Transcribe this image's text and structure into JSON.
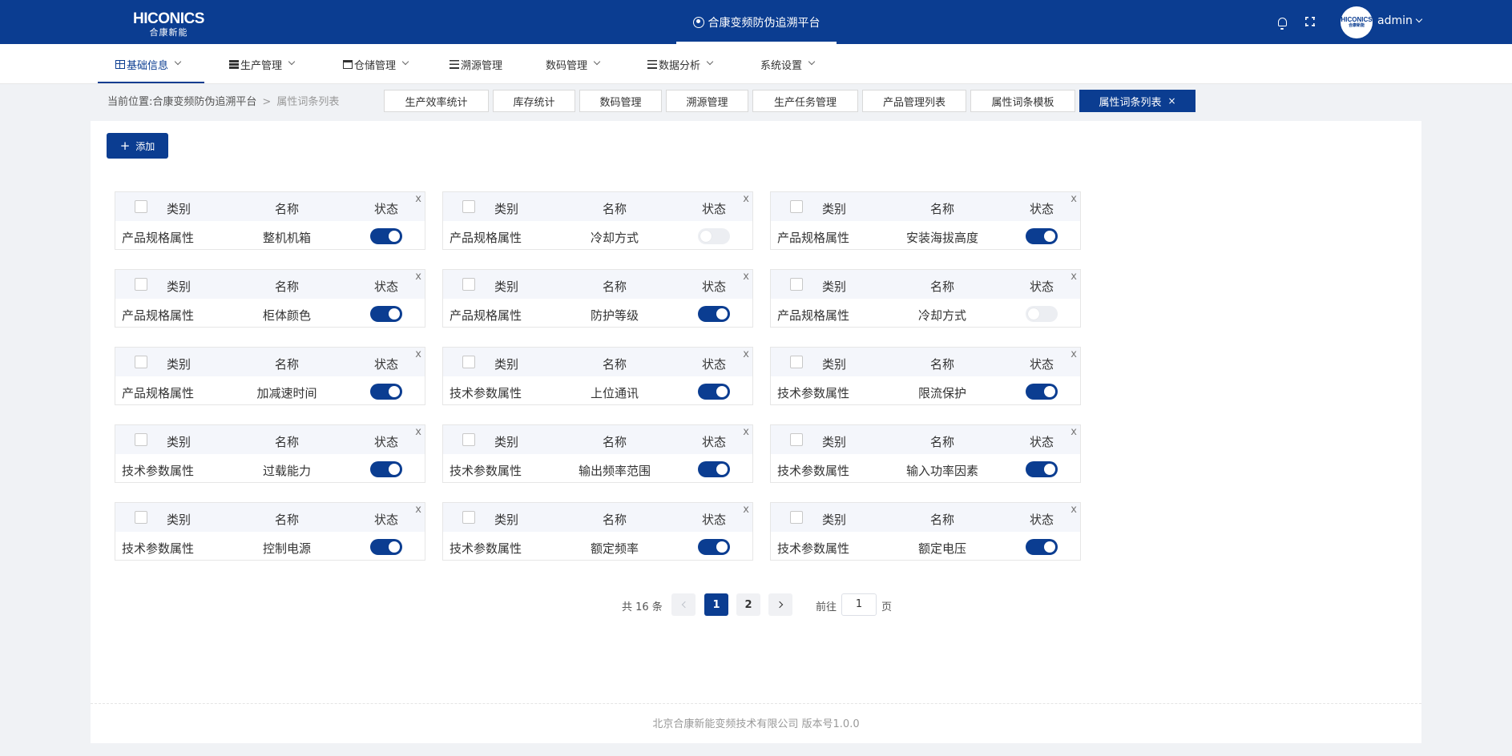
{
  "header": {
    "logo_en": "HICONICS",
    "logo_cn": "合康新能",
    "platform_title": "合康变频防伪追溯平台",
    "avatar_en": "HICONICS",
    "avatar_cn": "合康新能",
    "user": "admin"
  },
  "nav": [
    {
      "label": "基础信息",
      "icon": "grid-icon"
    },
    {
      "label": "生产管理",
      "icon": "server-icon"
    },
    {
      "label": "仓储管理",
      "icon": "archive-icon"
    },
    {
      "label": "溯源管理",
      "icon": "list-icon"
    },
    {
      "label": "数码管理",
      "icon": ""
    },
    {
      "label": "数据分析",
      "icon": "list-icon"
    },
    {
      "label": "系统设置",
      "icon": ""
    }
  ],
  "breadcrumb": {
    "prefix": "当前位置:",
    "home": "合康变频防伪追溯平台",
    "sep": ">",
    "current": "属性词条列表"
  },
  "tabs": [
    "生产效率统计",
    "库存统计",
    "数码管理",
    "溯源管理",
    "生产任务管理",
    "产品管理列表",
    "属性词条模板",
    "属性词条列表"
  ],
  "tab_close": "×",
  "add_button": {
    "icon": "+",
    "label": "添加"
  },
  "card_header": {
    "category": "类别",
    "name": "名称",
    "status": "状态",
    "close": "x"
  },
  "cards": [
    {
      "category": "产品规格属性",
      "name": "整机机箱",
      "enabled": true
    },
    {
      "category": "产品规格属性",
      "name": "冷却方式",
      "enabled": false
    },
    {
      "category": "产品规格属性",
      "name": "安装海拔高度",
      "enabled": true
    },
    {
      "category": "产品规格属性",
      "name": "柜体颜色",
      "enabled": true
    },
    {
      "category": "产品规格属性",
      "name": "防护等级",
      "enabled": true
    },
    {
      "category": "产品规格属性",
      "name": "冷却方式",
      "enabled": false
    },
    {
      "category": "产品规格属性",
      "name": "加减速时间",
      "enabled": true
    },
    {
      "category": "技术参数属性",
      "name": "上位通讯",
      "enabled": true
    },
    {
      "category": "技术参数属性",
      "name": "限流保护",
      "enabled": true
    },
    {
      "category": "技术参数属性",
      "name": "过载能力",
      "enabled": true
    },
    {
      "category": "技术参数属性",
      "name": "输出频率范围",
      "enabled": true
    },
    {
      "category": "技术参数属性",
      "name": "输入功率因素",
      "enabled": true
    },
    {
      "category": "技术参数属性",
      "name": "控制电源",
      "enabled": true
    },
    {
      "category": "技术参数属性",
      "name": "额定频率",
      "enabled": true
    },
    {
      "category": "技术参数属性",
      "name": "额定电压",
      "enabled": true
    }
  ],
  "pagination": {
    "total_text": "共 16 条",
    "pages": [
      "1",
      "2"
    ],
    "current": "1",
    "goto_label": "前往",
    "goto_value": "1",
    "goto_unit": "页"
  },
  "footer": "北京合康新能变频技术有限公司 版本号1.0.0",
  "colors": {
    "primary": "#0b3d91"
  }
}
